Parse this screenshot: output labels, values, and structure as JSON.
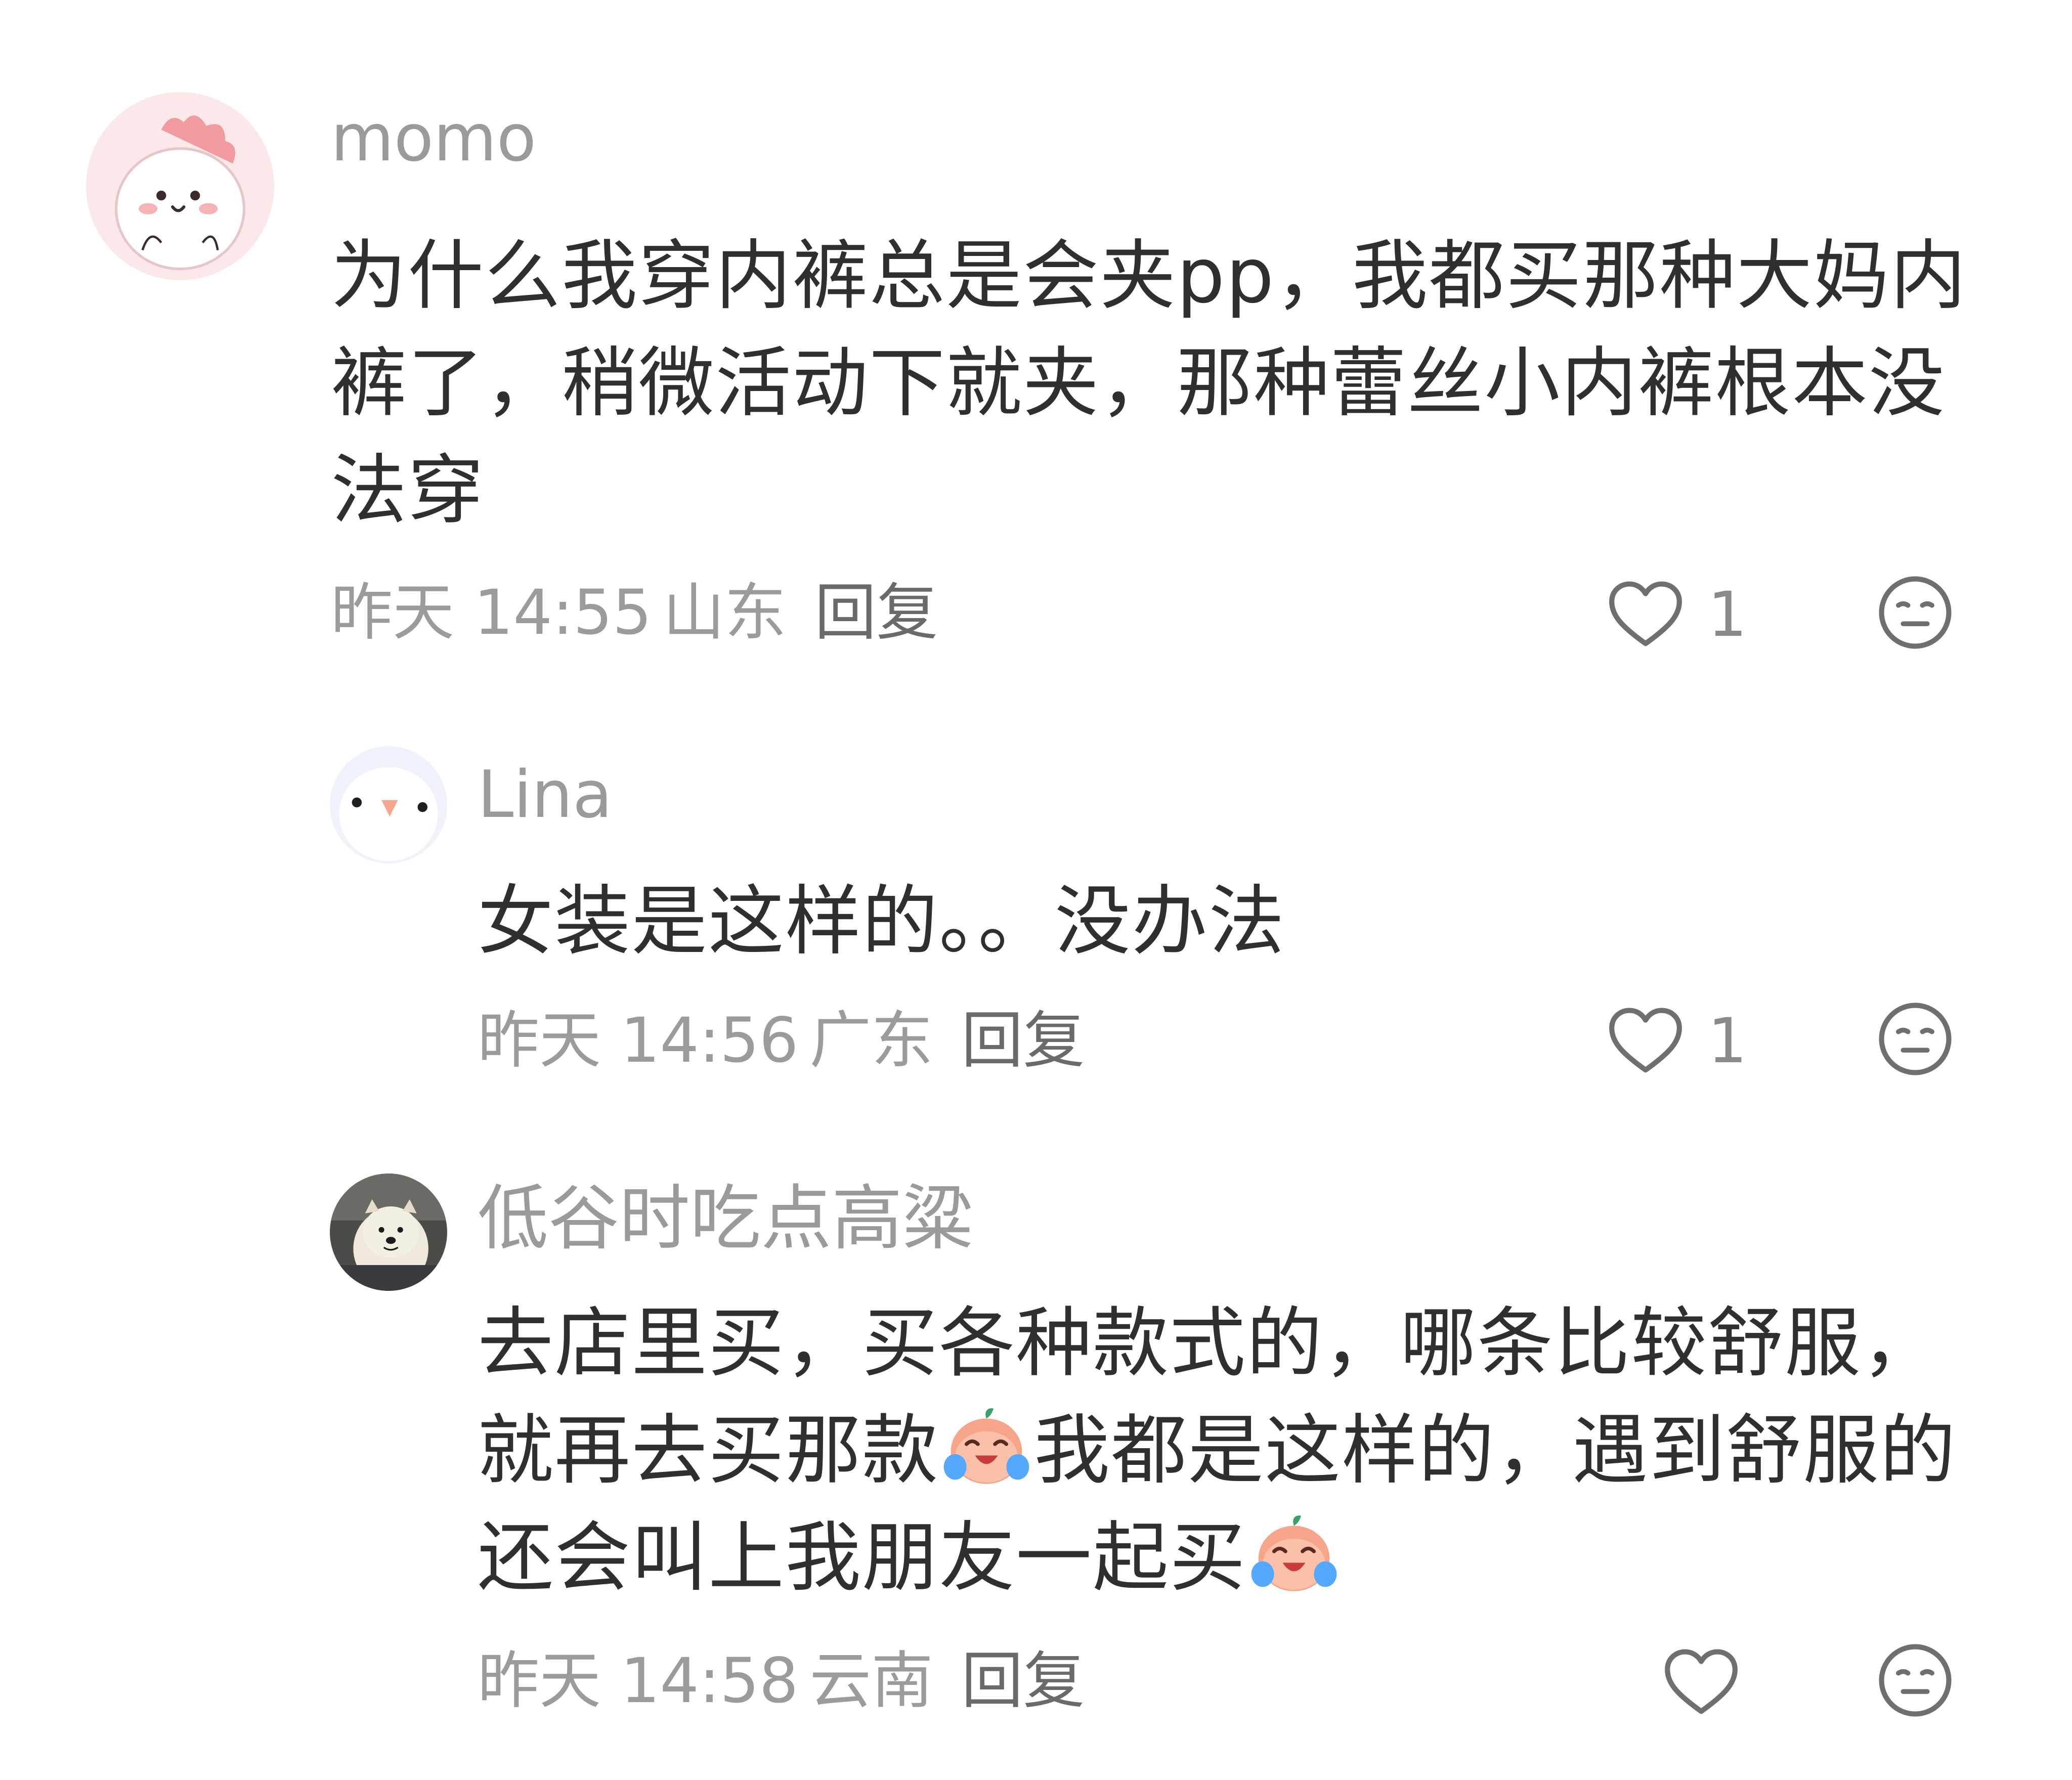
{
  "comments": [
    {
      "username": "momo",
      "text": "为什么我穿内裤总是会夹pp，我都买那种大妈内裤了，稍微活动下就夹，那种蕾丝小内裤根本没法穿",
      "time": "昨天 14:55",
      "location": "山东",
      "reply_label": "回复",
      "likes": "1",
      "avatar_icon": "pink-dino-avatar",
      "like_icon": "heart-outline-icon",
      "react_icon": "meh-face-icon"
    },
    {
      "username": "Lina",
      "text": "女装是这样的。。没办法",
      "time": "昨天 14:56",
      "location": "广东",
      "reply_label": "回复",
      "likes": "1",
      "avatar_icon": "white-bird-avatar",
      "like_icon": "heart-outline-icon",
      "react_icon": "meh-face-icon"
    },
    {
      "username": "低谷时吃点高粱",
      "text_parts": [
        "去店里买，买各种款式的，哪条比较舒服，就再去买那款",
        "我都是这样的，遇到舒服的还会叫上我朋友一起买",
        ""
      ],
      "time": "昨天 14:58",
      "location": "云南",
      "reply_label": "回复",
      "likes": "",
      "avatar_icon": "dog-photo-avatar",
      "emoji_icon": "crying-laughing-peach-emoji",
      "like_icon": "heart-outline-icon",
      "react_icon": "meh-face-icon"
    }
  ],
  "colors": {
    "username": "#9a9a9a",
    "text": "#2f2f2f",
    "meta": "#9b9b9b",
    "icon_stroke": "#6f6f6f",
    "background": "#ffffff"
  }
}
